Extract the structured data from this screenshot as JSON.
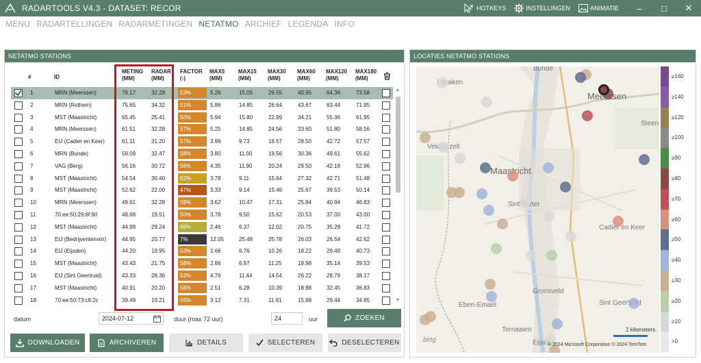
{
  "app": {
    "title": "RADARTOOLS V4.3 - DATASET: RECOR"
  },
  "titlebar": {
    "hotkeys": "HOTKEYS",
    "settings": "INSTELLINGEN",
    "animation": "ANIMATIE"
  },
  "menu": {
    "items": [
      "MENU",
      "RADARTELLINGEN",
      "RADARMETINGEN",
      "NETATMO",
      "ARCHIEF",
      "LEGENDA",
      "INFO"
    ],
    "active_index": 3
  },
  "left_panel": {
    "title": "NETATMO STATIONS"
  },
  "right_panel": {
    "title": "LOCATIES NETATMO STATIONS"
  },
  "table": {
    "headers": {
      "num": "#",
      "id": "ID",
      "meting": "METING",
      "meting_unit": "(MM)",
      "radar": "RADAR",
      "radar_unit": "(MM)",
      "factor": "FACTOR",
      "factor_unit": "(-)",
      "max5": "MAX5",
      "max15": "MAX15",
      "max30": "MAX30",
      "max60": "MAX60",
      "max120": "MAX120",
      "max180": "MAX180",
      "unit": "(MM)"
    },
    "rows": [
      {
        "n": "1",
        "id": "MRN (Meerssen)",
        "meting": "78.17",
        "radar": "32.28",
        "factor": "53%",
        "fcolor": "#d4862a",
        "max5": "5.26",
        "max15": "15.06",
        "max30": "26.55",
        "max60": "40.95",
        "max120": "64.36",
        "max180": "73.58",
        "checked": true
      },
      {
        "n": "2",
        "id": "MRN (Rothem)",
        "meting": "75.65",
        "radar": "34.32",
        "factor": "51%",
        "fcolor": "#d4862a",
        "max5": "5.86",
        "max15": "14.85",
        "max30": "26.64",
        "max60": "43.67",
        "max120": "63.44",
        "max180": "71.95",
        "checked": false
      },
      {
        "n": "3",
        "id": "MST (Maastricht)",
        "meting": "65.45",
        "radar": "25.41",
        "factor": "50%",
        "fcolor": "#d4862a",
        "max5": "5.94",
        "max15": "15.80",
        "max30": "22.99",
        "max60": "34.21",
        "max120": "55.36",
        "max180": "61.95",
        "checked": false
      },
      {
        "n": "4",
        "id": "MRN (Meerssen)",
        "meting": "61.51",
        "radar": "32.28",
        "factor": "57%",
        "fcolor": "#d4862a",
        "max5": "5.25",
        "max15": "14.85",
        "max30": "24.56",
        "max60": "33.60",
        "max120": "51.80",
        "max180": "58.56",
        "checked": false
      },
      {
        "n": "5",
        "id": "EIJ (Cadier en Keer)",
        "meting": "61.11",
        "radar": "31.20",
        "factor": "57%",
        "fcolor": "#d4862a",
        "max5": "3.99",
        "max15": "9.73",
        "max30": "16.57",
        "max60": "28.50",
        "max120": "42.72",
        "max180": "57.57",
        "checked": false
      },
      {
        "n": "6",
        "id": "MRN (Bunde)",
        "meting": "59.09",
        "radar": "32.47",
        "factor": "58%",
        "fcolor": "#d4862a",
        "max5": "3.80",
        "max15": "11.00",
        "max30": "19.56",
        "max60": "30.36",
        "max120": "49.61",
        "max180": "55.62",
        "checked": false
      },
      {
        "n": "7",
        "id": "VAG (Berg)",
        "meting": "56.16",
        "radar": "30.72",
        "factor": "56%",
        "fcolor": "#d4862a",
        "max5": "4.35",
        "max15": "11.90",
        "max30": "20.24",
        "max60": "29.50",
        "max120": "42.18",
        "max180": "52.96",
        "checked": false
      },
      {
        "n": "8",
        "id": "MST (Maastricht)",
        "meting": "54.54",
        "radar": "30.40",
        "factor": "62%",
        "fcolor": "#c9a026",
        "max5": "3.78",
        "max15": "9.11",
        "max30": "15.64",
        "max60": "27.32",
        "max120": "42.71",
        "max180": "51.48",
        "checked": false
      },
      {
        "n": "9",
        "id": "MST (Maastricht)",
        "meting": "52.62",
        "radar": "22.00",
        "factor": "47%",
        "fcolor": "#b5561a",
        "max5": "3.33",
        "max15": "9.14",
        "max30": "15.46",
        "max60": "25.67",
        "max120": "39.53",
        "max180": "50.14",
        "checked": false
      },
      {
        "n": "10",
        "id": "MRN (Meerssen)",
        "meting": "49.61",
        "radar": "32.28",
        "factor": "59%",
        "fcolor": "#d4862a",
        "max5": "3.62",
        "max15": "10.47",
        "max30": "17.31",
        "max60": "25.84",
        "max120": "40.94",
        "max180": "46.83",
        "checked": false
      },
      {
        "n": "11",
        "id": "70:ee:50:29:6f:90",
        "meting": "48.68",
        "radar": "19.51",
        "factor": "50%",
        "fcolor": "#d4862a",
        "max5": "3.78",
        "max15": "9.50",
        "max30": "15.62",
        "max60": "20.53",
        "max120": "37.00",
        "max180": "43.00",
        "checked": false
      },
      {
        "n": "12",
        "id": "MST (Maastricht)",
        "meting": "44.99",
        "radar": "29.24",
        "factor": "66%",
        "fcolor": "#b8ad3a",
        "max5": "2.46",
        "max15": "6.37",
        "max30": "12.02",
        "max60": "20.75",
        "max120": "35.28",
        "max180": "41.72",
        "checked": false
      },
      {
        "n": "13",
        "id": "EIJ (Bedrijventerrein)",
        "meting": "44.95",
        "radar": "20.77",
        "factor": "7%",
        "fcolor": "#3a3a3a",
        "max5": "12.05",
        "max15": "25.48",
        "max30": "25.78",
        "max60": "26.03",
        "max120": "26.54",
        "max180": "42.62",
        "checked": false
      },
      {
        "n": "14",
        "id": "EIJ (Eijsden)",
        "meting": "44.20",
        "radar": "19.95",
        "factor": "53%",
        "fcolor": "#d4862a",
        "max5": "2.66",
        "max15": "6.76",
        "max30": "10.26",
        "max60": "18.22",
        "max120": "29.49",
        "max180": "40.73",
        "checked": false
      },
      {
        "n": "15",
        "id": "MST (Maastricht)",
        "meting": "43.43",
        "radar": "21.75",
        "factor": "58%",
        "fcolor": "#d4862a",
        "max5": "2.86",
        "max15": "6.97",
        "max30": "11.25",
        "max60": "19.98",
        "max120": "35.14",
        "max180": "39.53",
        "checked": false
      },
      {
        "n": "16",
        "id": "EIJ (Sint Geertruid)",
        "meting": "43.33",
        "radar": "28.36",
        "factor": "52%",
        "fcolor": "#d4862a",
        "max5": "4.76",
        "max15": "11.44",
        "max30": "14.54",
        "max60": "26.22",
        "max120": "28.79",
        "max180": "38.17",
        "checked": false
      },
      {
        "n": "17",
        "id": "MST (Maastricht)",
        "meting": "40.91",
        "radar": "20.20",
        "factor": "58%",
        "fcolor": "#d4862a",
        "max5": "2.51",
        "max15": "6.28",
        "max30": "10.39",
        "max60": "18.98",
        "max120": "32.45",
        "max180": "36.83",
        "checked": false
      },
      {
        "n": "18",
        "id": "70:ee:50:73:c8:2c",
        "meting": "39.49",
        "radar": "19.21",
        "factor": "55%",
        "fcolor": "#d4862a",
        "max5": "3.12",
        "max15": "7.31",
        "max30": "11.91",
        "max60": "15.98",
        "max120": "29.44",
        "max180": "34.85",
        "checked": false
      }
    ]
  },
  "controls": {
    "datum_label": "datum",
    "datum_value": "2024-07-12",
    "duur_label": "duur (max 72 uur)",
    "duur_value": "24",
    "uur_label": "uur",
    "search_label": "ZOEKEN",
    "download_label": "DOWNLOADEN",
    "archive_label": "ARCHIVEREN",
    "details_label": "DETAILS",
    "select_label": "SELECTEREN",
    "deselect_label": "DESELECTEREN"
  },
  "map": {
    "labels": [
      "Bunde",
      "Lanaken",
      "Meerssen",
      "Veldwezelt",
      "Maastricht",
      "Sint-Pieter",
      "Cadier en Keer",
      "Gronsveld",
      "Eijsden",
      "Eben-Emael",
      "Ternaaien",
      "Sint Geertruid",
      "Steen"
    ],
    "scale": "2 kilometers",
    "copyright": "© 2024 Microsoft Corporation   © 2024 TomTom",
    "bing": "bing",
    "legend": [
      {
        "label": "≥160",
        "color": "#7a4a8a"
      },
      {
        "label": "≥140",
        "color": "#8a5aa8"
      },
      {
        "label": "≥120",
        "color": "#9a8050"
      },
      {
        "label": "≥100",
        "color": "#8a8a8a"
      },
      {
        "label": "≥90",
        "color": "#4a8a4a"
      },
      {
        "label": "≥80",
        "color": "#8a4a4a"
      },
      {
        "label": "≥70",
        "color": "#c05060"
      },
      {
        "label": "≥60",
        "color": "#d8907a"
      },
      {
        "label": "≥50",
        "color": "#607090"
      },
      {
        "label": "≥40",
        "color": "#a0b4dc"
      },
      {
        "label": "≥30",
        "color": "#c8b090"
      },
      {
        "label": "≥20",
        "color": "#b8d0a8"
      },
      {
        "label": "≥10",
        "color": "#d8d8d8"
      },
      {
        "label": ">0",
        "color": "#e8e8e8"
      }
    ]
  }
}
